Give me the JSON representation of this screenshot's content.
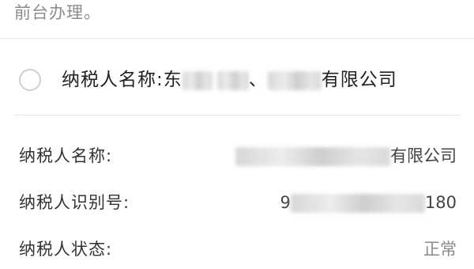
{
  "note": {
    "text": "前台办理。"
  },
  "option": {
    "prefix": "纳税人名称:东",
    "middle": "、",
    "suffix": "有限公司",
    "selected": false
  },
  "info": {
    "name_label": "纳税人名称:",
    "name_value_suffix": "有限公司",
    "id_label": "纳税人识别号:",
    "id_value_prefix": "9",
    "id_value_suffix": "180",
    "status_label": "纳税人状态:",
    "status_value": "正常"
  }
}
